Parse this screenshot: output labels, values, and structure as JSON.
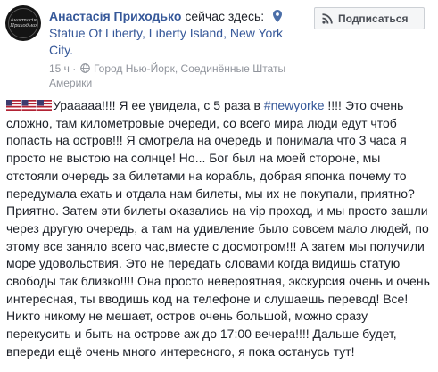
{
  "post": {
    "author": "Анастасія Приходько",
    "here_label": "сейчас здесь:",
    "location_name": "Statue Of Liberty, Liberty Island, New York City.",
    "timestamp": "15 ч",
    "separator": " · ",
    "place": "Город Нью-Йорк, Соединённые Штаты Америки",
    "follow_label": "Подписаться",
    "avatar_logo_text": "Анастасія Приходько",
    "text_after_flags": "Урааааа!!!! Я ее увидела, с 5 раза в ",
    "hashtag": "#newyorke",
    "text_rest": " !!!! Это очень сложно, там километровые очереди, со всего мира люди едут чтоб попасть на остров!!! Я смотрела на очередь и понимала что 3 часа я просто не выстою на солнце! Но... Бог был на моей стороне, мы отстояли очередь за билетами на корабль, добрая японка почему то передумала ехать и отдала нам билеты, мы их не покупали, приятно? Приятно. Затем эти билеты оказались на vip проход, и мы просто зашли через другую очередь, а там на удивление было совсем мало людей, по этому все заняло всего час,вместе с досмотром!!! А затем мы получили море удовольствия. Это не передать словами когда видишь статую свободы так близко!!!! Она просто невероятная, экскурсия очень и очень интересная, ты вводишь код на телефоне и слушаешь перевод! Все! Никто никому не мешает, остров очень большой, можно сразу перекусить и быть на острове аж до 17:00 вечера!!!! Дальше будет, впереди ещё очень много интересного, я пока останусь тут!"
  },
  "icons": {
    "pin": "map-pin-icon",
    "globe": "globe-icon",
    "rss": "rss-icon",
    "flags": "us-flag-icon"
  },
  "colors": {
    "link": "#365899",
    "text": "#1d2129",
    "meta": "#90949c",
    "button_bg": "#f5f6f7",
    "button_border": "#ccd0d5"
  }
}
